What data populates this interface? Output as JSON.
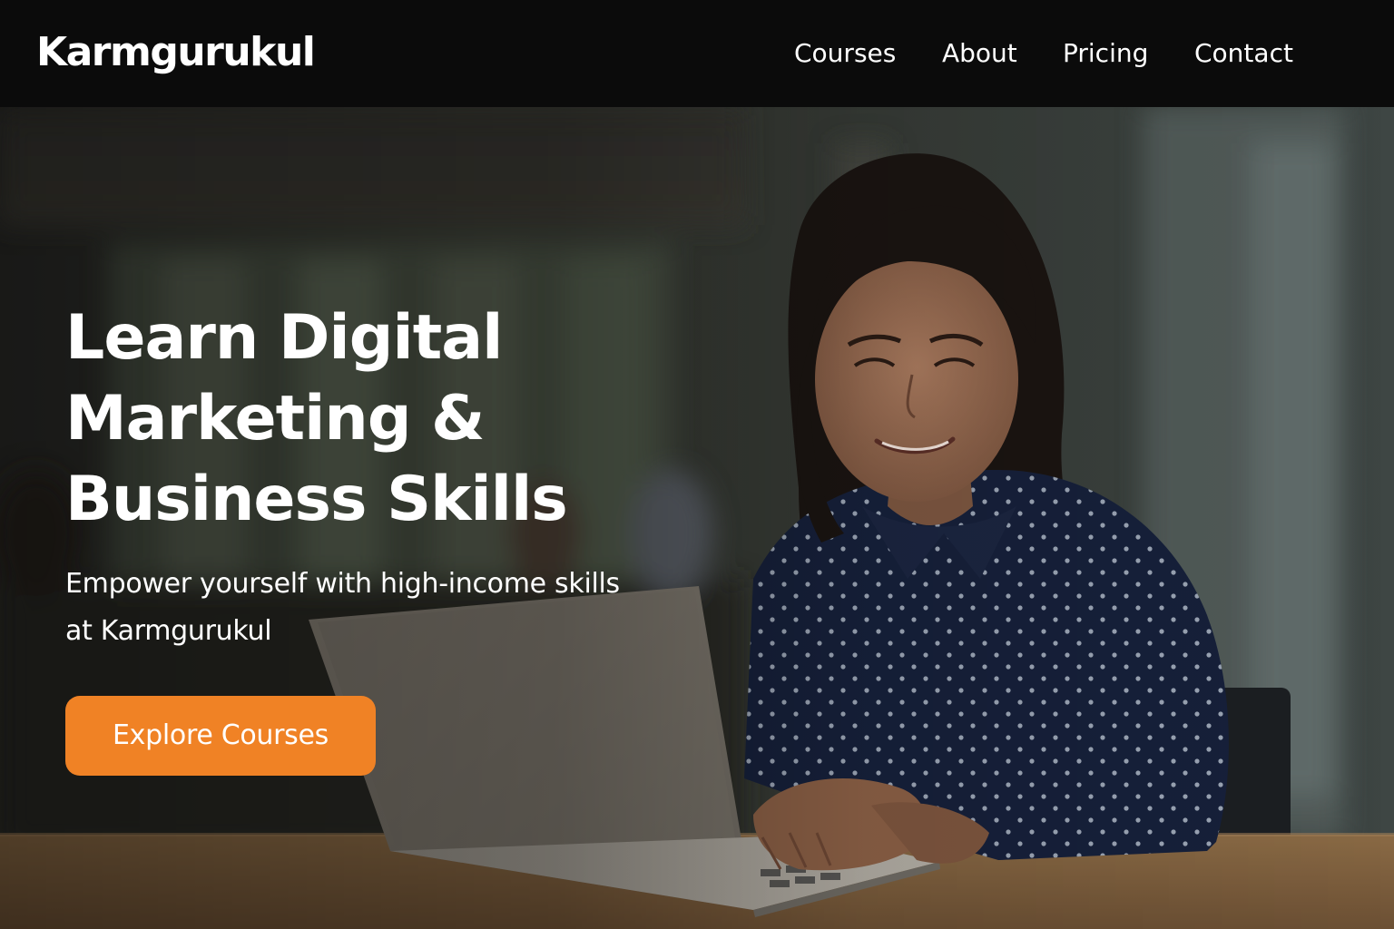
{
  "header": {
    "logo": "Karmgurukul",
    "nav": [
      "Courses",
      "About",
      "Pricing",
      "Contact"
    ]
  },
  "hero": {
    "title_lines": [
      "Learn Digital",
      "Marketing &",
      "Business Skills"
    ],
    "subtitle_lines": [
      "Empower yourself with high-income skills",
      "at Karmgurukul"
    ],
    "cta": "Explore Courses"
  },
  "colors": {
    "header_bg": "#0b0b0b",
    "cta_bg": "#f08225",
    "text": "#ffffff"
  },
  "icons": {
    "hero_photo": "woman-using-laptop-image"
  }
}
